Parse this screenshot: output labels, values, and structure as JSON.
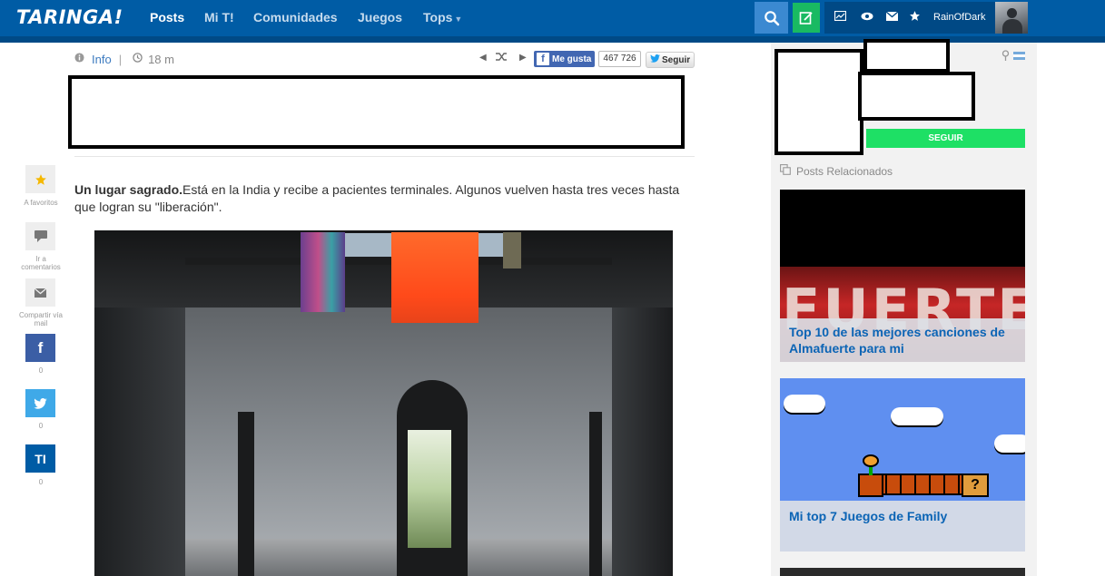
{
  "header": {
    "logo": "TARINGA!",
    "nav": [
      {
        "label": "Posts"
      },
      {
        "label": "Mi T!"
      },
      {
        "label": "Comunidades"
      },
      {
        "label": "Juegos"
      },
      {
        "label": "Tops"
      }
    ],
    "username": "RainOfDark"
  },
  "meta": {
    "info_label": "Info",
    "separator": "|",
    "time": "18 m"
  },
  "social": {
    "fb_like": "Me gusta",
    "fb_count": "467 726",
    "tw_follow": "Seguir"
  },
  "side_actions": [
    {
      "label": "A favoritos",
      "icon": "star-icon"
    },
    {
      "label": "Ir a comentarios",
      "icon": "comment-icon"
    },
    {
      "label": "Compartir vía mail",
      "icon": "mail-icon"
    },
    {
      "label": "0",
      "icon": "facebook-icon"
    },
    {
      "label": "0",
      "icon": "twitter-icon"
    },
    {
      "label": "0",
      "icon": "taringa-icon"
    }
  ],
  "post": {
    "lead_bold": "Un lugar sagrado.",
    "lead_text": "Está en la India y recibe a pacientes terminales. Algunos vuelven hasta tres veces hasta que logran su \"liberación\"."
  },
  "sidebar": {
    "follow_button": "SEGUIR",
    "related_title": "Posts Relacionados",
    "related": [
      {
        "title": "Top 10 de las mejores canciones de Almafuerte para mi",
        "image_text": "FUERTE"
      },
      {
        "title": "Mi top 7 Juegos de Family",
        "image_text": "?"
      }
    ]
  },
  "colors": {
    "topbar": "#005ca5",
    "search_btn": "#3b89d1",
    "write_btn": "#19ba62",
    "follow_btn": "#1ee065",
    "link": "#0b64b5"
  }
}
